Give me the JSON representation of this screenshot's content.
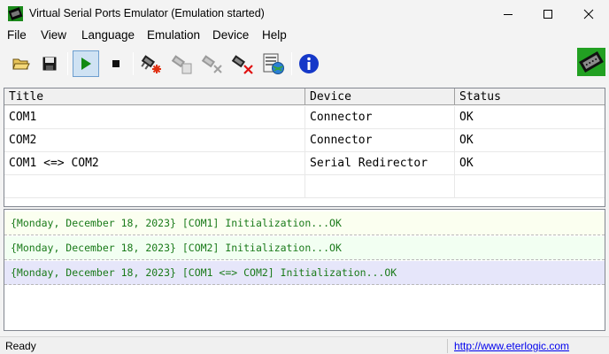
{
  "window": {
    "title": "Virtual Serial Ports Emulator (Emulation started)"
  },
  "menu": [
    "File",
    "View",
    "Language",
    "Emulation",
    "Device",
    "Help"
  ],
  "toolbar": {
    "icons": [
      "open-folder-icon",
      "save-icon",
      "start-icon",
      "stop-icon",
      "add-device-icon",
      "edit-device-icon",
      "remove-device-icon",
      "delete-all-icon",
      "network-settings-icon",
      "info-icon",
      "device-logo-icon"
    ],
    "start_pressed": true
  },
  "device_list": {
    "columns": [
      "Title",
      "Device",
      "Status"
    ],
    "rows": [
      {
        "title": "COM1",
        "device": "Connector",
        "status": "OK"
      },
      {
        "title": "COM2",
        "device": "Connector",
        "status": "OK"
      },
      {
        "title": "COM1 <=> COM2",
        "device": "Serial Redirector",
        "status": "OK"
      }
    ]
  },
  "log": {
    "entries": [
      {
        "text": "{Monday, December 18, 2023} [COM1] Initialization...OK",
        "bg": "#fbfff0"
      },
      {
        "text": "{Monday, December 18, 2023} [COM2] Initialization...OK",
        "bg": "#f2fff2"
      },
      {
        "text": "{Monday, December 18, 2023} [COM1 <=> COM2] Initialization...OK",
        "bg": "#e6e6fa"
      }
    ]
  },
  "status_bar": {
    "text": "Ready",
    "link": "http://www.eterlogic.com"
  }
}
